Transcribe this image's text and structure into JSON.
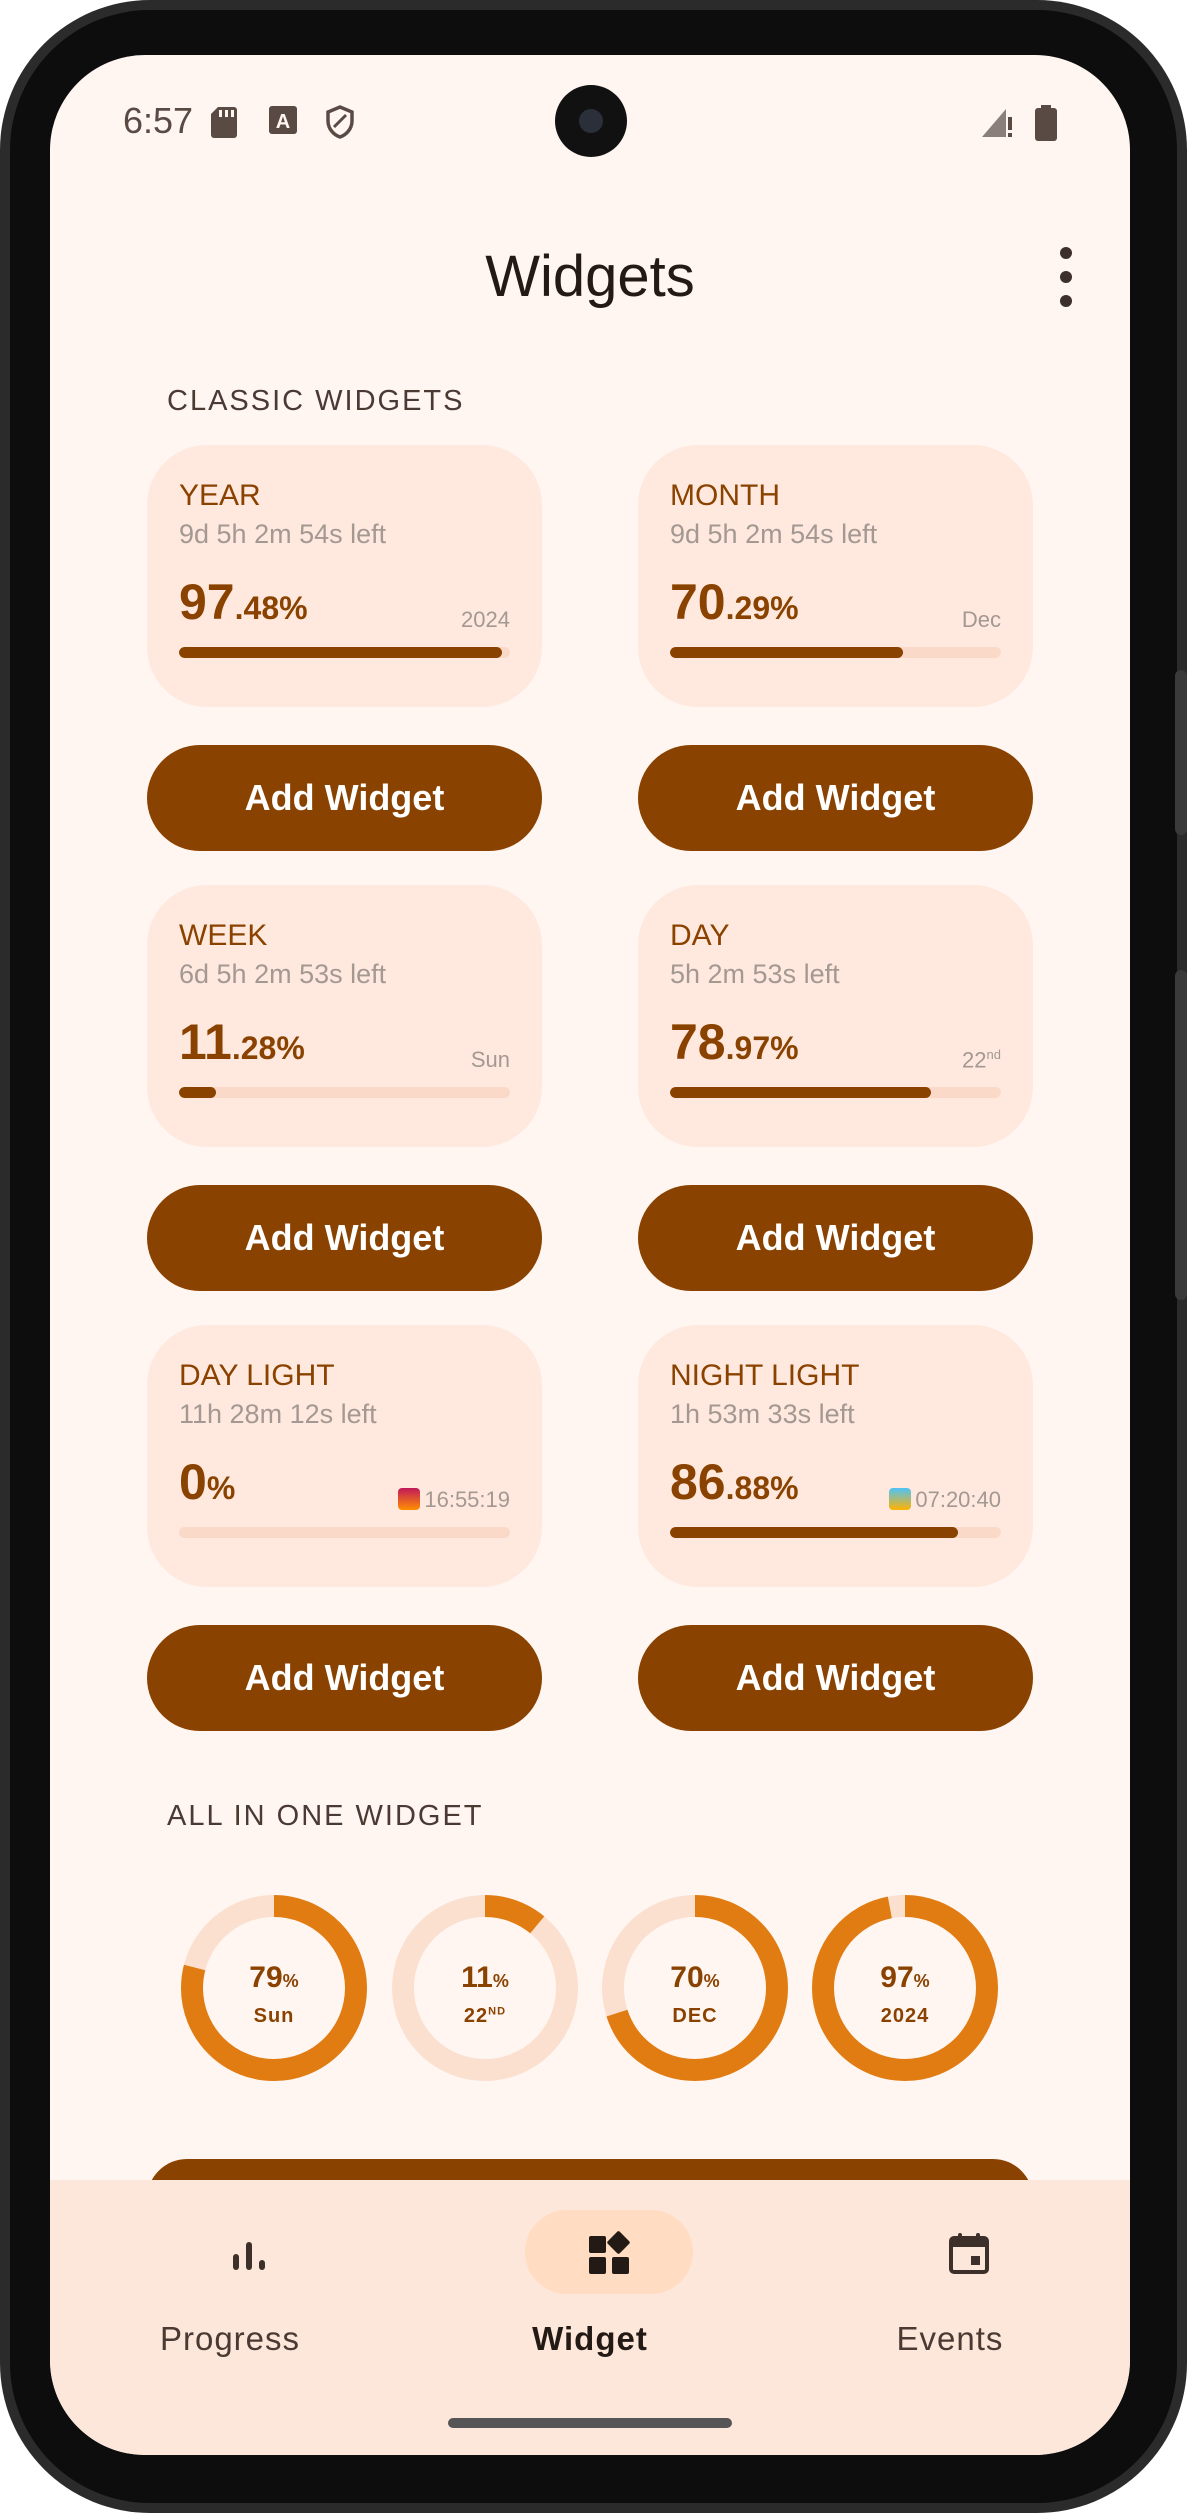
{
  "status_bar": {
    "time": "6:57",
    "left_icons": [
      "sd-card-icon",
      "text-a-icon",
      "shield-icon"
    ],
    "right_icons": [
      "signal-icon",
      "battery-icon"
    ]
  },
  "header": {
    "title": "Widgets"
  },
  "sections": {
    "classic": "CLASSIC WIDGETS",
    "all_in_one": "ALL IN ONE WIDGET"
  },
  "cards": [
    {
      "label": "YEAR",
      "left": "9d 5h 2m 54s left",
      "pct_int": "97",
      "pct_dec": ".48%",
      "side": "2024",
      "progress": 0.9748
    },
    {
      "label": "MONTH",
      "left": "9d 5h 2m 54s left",
      "pct_int": "70",
      "pct_dec": ".29%",
      "side": "Dec",
      "progress": 0.7029
    },
    {
      "label": "WEEK",
      "left": "6d 5h 2m 53s left",
      "pct_int": "11",
      "pct_dec": ".28%",
      "side": "Sun",
      "progress": 0.1128
    },
    {
      "label": "DAY",
      "left": "5h 2m 53s left",
      "pct_int": "78",
      "pct_dec": ".97%",
      "side": "22",
      "side_sup": "nd",
      "progress": 0.7897
    },
    {
      "label": "DAY LIGHT",
      "left": "11h 28m 12s left",
      "pct_int": "0",
      "pct_dec": "%",
      "side": "16:55:19",
      "side_icon": "sunset-icon",
      "progress": 0
    },
    {
      "label": "NIGHT LIGHT",
      "left": "1h 53m 33s left",
      "pct_int": "86",
      "pct_dec": ".88%",
      "side": "07:20:40",
      "side_icon": "sunrise-icon",
      "progress": 0.8688
    }
  ],
  "add_widget_label": "Add Widget",
  "rings": [
    {
      "value": "79",
      "unit": "%",
      "sub": "Sun",
      "progress": 0.79
    },
    {
      "value": "11",
      "unit": "%",
      "sub": "22",
      "sub_sup": "ND",
      "progress": 0.11
    },
    {
      "value": "70",
      "unit": "%",
      "sub": "DEC",
      "progress": 0.7
    },
    {
      "value": "97",
      "unit": "%",
      "sub": "2024",
      "progress": 0.97
    }
  ],
  "nav": {
    "items": [
      {
        "label": "Progress",
        "icon": "bar-chart-icon",
        "active": false
      },
      {
        "label": "Widget",
        "icon": "widgets-icon",
        "active": true
      },
      {
        "label": "Events",
        "icon": "calendar-icon",
        "active": false
      }
    ]
  },
  "colors": {
    "accent": "#8a4200",
    "ring_accent": "#e07c12",
    "ring_track": "#fbe0d0",
    "card_bg": "#ffe9de",
    "background": "#fff6f2",
    "navbar_bg": "#fde7da"
  }
}
